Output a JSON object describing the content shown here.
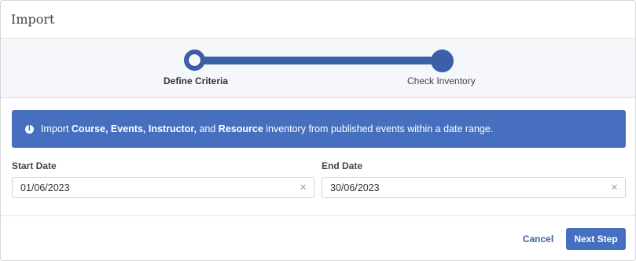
{
  "dialog": {
    "title": "Import"
  },
  "stepper": {
    "steps": [
      {
        "label": "Define Criteria",
        "state": "current"
      },
      {
        "label": "Check Inventory",
        "state": "upcoming"
      }
    ]
  },
  "alert": {
    "icon": "info-icon",
    "text_prefix": "Import ",
    "bold_1": "Course, Events, Instructor,",
    "text_and": " and ",
    "bold_2": "Resource",
    "text_suffix": " inventory from published events within a date range."
  },
  "form": {
    "start_date": {
      "label": "Start Date",
      "value": "01/06/2023",
      "clear_glyph": "×"
    },
    "end_date": {
      "label": "End Date",
      "value": "30/06/2023",
      "clear_glyph": "×"
    }
  },
  "footer": {
    "cancel_label": "Cancel",
    "next_label": "Next Step"
  },
  "colors": {
    "accent": "#4670bf",
    "track": "#3b5fa8"
  }
}
